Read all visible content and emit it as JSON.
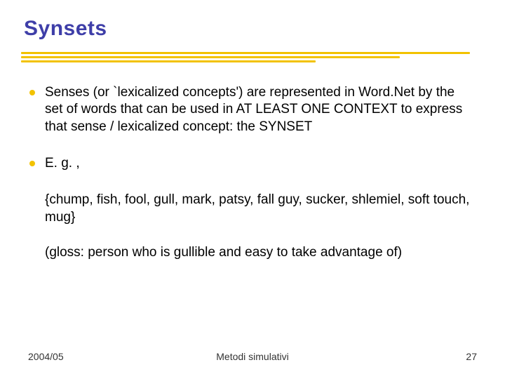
{
  "title": "Synsets",
  "bullets": [
    "Senses (or `lexicalized concepts') are represented in Word.Net by the set of words that can be used in AT LEAST ONE CONTEXT  to express that sense / lexicalized concept: the SYNSET",
    "E. g. ,"
  ],
  "paragraphs": [
    "{chump, fish, fool, gull, mark, patsy, fall guy, sucker, shlemiel, soft touch, mug}",
    "(gloss: person who is gullible and easy to take advantage of)"
  ],
  "footer": {
    "left": "2004/05",
    "center": "Metodi simulativi",
    "right": "27"
  }
}
